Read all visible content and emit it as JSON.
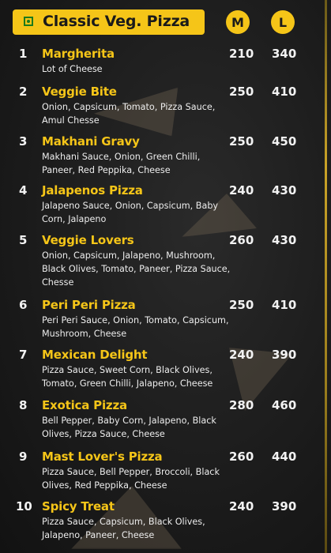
{
  "header": {
    "title": "Classic Veg. Pizza",
    "size_medium": "M",
    "size_large": "L",
    "veg_icon": "veg-symbol-icon"
  },
  "colors": {
    "accent": "#f5c518",
    "background": "#1c1c1c",
    "text": "#f2f2f2",
    "veg_green": "#1d7a1d"
  },
  "items": [
    {
      "num": "1",
      "name": "Margherita",
      "desc": "Lot of Cheese",
      "price_m": "210",
      "price_l": "340"
    },
    {
      "num": "2",
      "name": "Veggie Bite",
      "desc": "Onion, Capsicum, Tomato, Pizza Sauce, Amul Chesse",
      "price_m": "250",
      "price_l": "410"
    },
    {
      "num": "3",
      "name": "Makhani Gravy",
      "desc": "Makhani Sauce, Onion, Green Chilli, Paneer, Red Peppika, Cheese",
      "price_m": "250",
      "price_l": "450"
    },
    {
      "num": "4",
      "name": "Jalapenos Pizza",
      "desc": "Jalapeno Sauce, Onion, Capsicum, Baby Corn, Jalapeno",
      "price_m": "240",
      "price_l": "430"
    },
    {
      "num": "5",
      "name": "Veggie Lovers",
      "desc": "Onion, Capsicum, Jalapeno, Mushroom, Black Olives, Tomato, Paneer, Pizza Sauce, Chesse",
      "price_m": "260",
      "price_l": "430"
    },
    {
      "num": "6",
      "name": "Peri Peri Pizza",
      "desc": "Peri Peri Sauce, Onion, Tomato, Capsicum, Mushroom, Cheese",
      "price_m": "250",
      "price_l": "410"
    },
    {
      "num": "7",
      "name": "Mexican Delight",
      "desc": "Pizza Sauce, Sweet Corn, Black Olives, Tomato, Green Chilli, Jalapeno, Cheese",
      "price_m": "240",
      "price_l": "390"
    },
    {
      "num": "8",
      "name": "Exotica Pizza",
      "desc": "Bell Pepper, Baby Corn, Jalapeno, Black Olives, Pizza Sauce, Cheese",
      "price_m": "280",
      "price_l": "460"
    },
    {
      "num": "9",
      "name": "Mast Lover's Pizza",
      "desc": "Pizza Sauce, Bell Pepper, Broccoli, Black Olives, Red Peppika, Cheese",
      "price_m": "260",
      "price_l": "440"
    },
    {
      "num": "10",
      "name": "Spicy Treat",
      "desc": "Pizza Sauce, Capsicum, Black Olives, Jalapeno, Paneer, Cheese",
      "price_m": "240",
      "price_l": "390"
    }
  ]
}
